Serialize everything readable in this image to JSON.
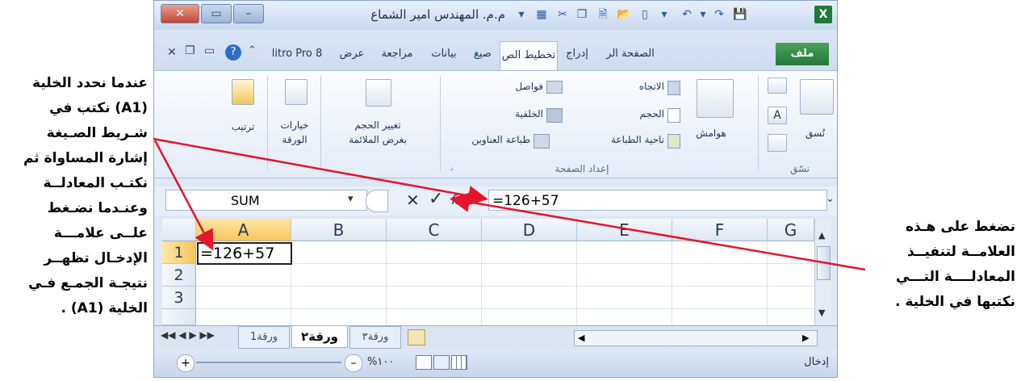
{
  "left_note": {
    "lines": [
      "عندما نحدد الخلية",
      "(A1) نكتب في",
      "شـريط الصـيغة",
      "إشارة المساواة ثم",
      "نكتـب المعادلــة",
      "وعنـدما نضـغط",
      "علــى علامـــة",
      "الإدخـال تظهــر",
      "نتيجـة الجمـع فـي",
      "الخلية (A1) ."
    ]
  },
  "right_note": {
    "lines": [
      "نضغط على هـذه",
      "العلامــة لتنفيــذ",
      "المعادلــــة التـــي",
      "نكتبها في الخلية ."
    ]
  },
  "window": {
    "title": "م.م. المهندس امير الشماع",
    "excel_icon": "excel-icon"
  },
  "ribbon_tabs": [
    {
      "label": "ملف"
    },
    {
      "label": "الصفحة الر"
    },
    {
      "label": "إدراج"
    },
    {
      "label": "تخطيط الص"
    },
    {
      "label": "صيغ"
    },
    {
      "label": "بيانات"
    },
    {
      "label": "مراجعة"
    },
    {
      "label": "عرض"
    },
    {
      "label": "litro Pro 8"
    }
  ],
  "ribbon": {
    "themes_group": {
      "label": "نسّق",
      "button": "نُسق"
    },
    "page_setup": {
      "label": "إعداد الصفحة",
      "margins": "هوامش",
      "orientation": "الاتجاه",
      "size": "الحجم",
      "print_area": "ناحية الطباعة",
      "breaks": "فواصل",
      "background": "الخلفية",
      "print_titles": "طباعة العناوين"
    },
    "scale": {
      "line1": "تغيير الحجم",
      "line2": "بغرض الملائمة"
    },
    "sheet_options": {
      "line1": "خيارات",
      "line2": "الورقة"
    },
    "arrange": {
      "label": "ترتيب"
    }
  },
  "formula_bar": {
    "name_box": "SUM",
    "fx": "fx",
    "formula": "=126+57"
  },
  "grid": {
    "columns": [
      "A",
      "B",
      "C",
      "D",
      "E",
      "F",
      "G"
    ],
    "rows": [
      "1",
      "2",
      "3"
    ],
    "a1_value": "=126+57"
  },
  "sheet_tabs": [
    "ورقة1",
    "ورقة٢",
    "ورقة٣"
  ],
  "status": {
    "mode": "إدخال",
    "zoom": "%١٠٠"
  }
}
